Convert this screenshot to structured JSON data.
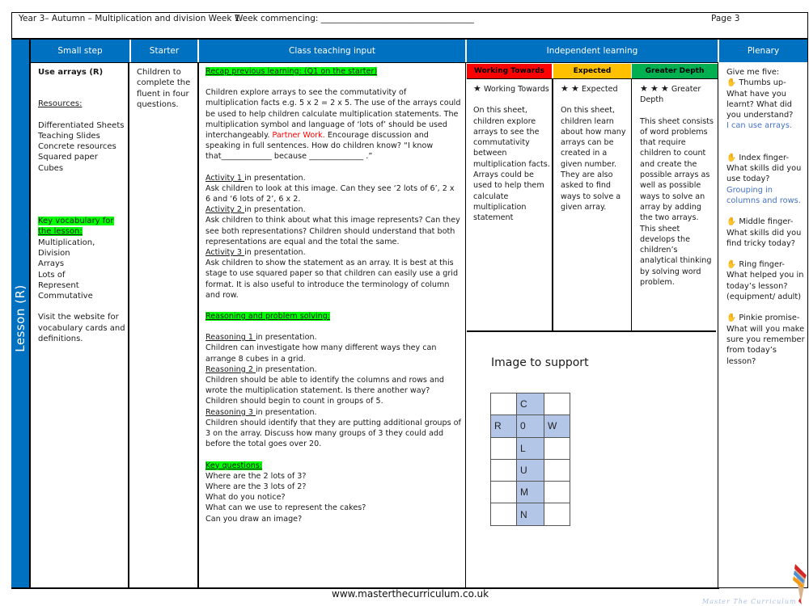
{
  "header": {
    "title": "Year 3– Autumn – Multiplication and division Week  1",
    "week_commencing": "Week commencing: ____________________________________",
    "page": "Page 3"
  },
  "side_label": "Lesson  (R)",
  "columns": {
    "small_step": "Small step",
    "starter": "Starter",
    "class_teaching": "Class teaching input",
    "independent": "Independent learning",
    "plenary": "Plenary"
  },
  "small_step": {
    "title": "Use arrays (R)",
    "resources_heading": "Resources:",
    "resources": [
      "Differentiated Sheets",
      "Teaching Slides",
      "Concrete resources",
      "Squared paper",
      "Cubes"
    ],
    "vocab_heading_1": "Key vocabulary for",
    "vocab_heading_2": "the lesson:",
    "vocabulary": [
      "Multiplication,",
      "Division",
      "Arrays",
      "Lots of",
      "Represent",
      "Commutative"
    ],
    "website_note": "Visit the website for vocabulary cards and definitions."
  },
  "starter": {
    "text": "Children to complete the fluent in four questions."
  },
  "teaching": {
    "recap_heading": "Recap previous learning: (Q1 on the starter)",
    "intro": "Children explore arrays to see the commutativity of multiplication facts e.g. 5 x 2 = 2 x 5. The use of the arrays could be used to help children calculate multiplication statements. The multiplication symbol and language of ‘lots of’ should be used interchangeably.",
    "partner_work": "Partner Work.",
    "partner_rest": " Encourage discussion and speaking in full sentences. How do children know?  “I know that_____________ because ______________ .”",
    "activities": [
      {
        "label": "Activity 1 ",
        "suffix": "in presentation.",
        "text": "Ask children to look at this image. Can they see ‘2 lots of 6’, 2 x 6 and  ‘6 lots of 2’, 6 x 2."
      },
      {
        "label": "Activity 2 ",
        "suffix": "in presentation.",
        "text": "Ask children to think about what this image represents? Can they see both representations? Children should understand that both representations are equal and the total the same."
      },
      {
        "label": "Activity 3 ",
        "suffix": "in presentation.",
        "text": "Ask children to show the statement as an array. It is best at this stage to use squared paper so that children can easily use a grid format. It is also useful to introduce the terminology of column and row."
      }
    ],
    "reasoning_heading": "Reasoning and problem solving:",
    "reasoning": [
      {
        "label": "Reasoning 1 ",
        "suffix": "in presentation.",
        "text": "Children can investigate how many different ways they can arrange 8 cubes in a grid."
      },
      {
        "label": "Reasoning 2 ",
        "suffix": "in presentation.",
        "text": "Children should be able to identify the columns and rows and wrote the multiplication statement.  Is there another way? Children should begin to count in groups of 5."
      },
      {
        "label": "Reasoning 3 ",
        "suffix": "in presentation.",
        "text": "Children should identify that they are putting additional groups of 3 on the array. Discuss how many groups of 3 they could add before the total goes over 20."
      }
    ],
    "key_questions_heading": "Key questions:",
    "key_questions": [
      "Where are the 2 lots of 3?",
      "Where are the 3 lots of 2?",
      "What do you notice?",
      "What can we use to represent the cakes?",
      "Can you draw an image?"
    ]
  },
  "independent": {
    "levels": [
      {
        "band": "Working Towards",
        "color": "#ff0000",
        "stars": 1,
        "title": "Working Towards",
        "text": "On this sheet, children explore arrays to see the commutativity between multiplication facts. Arrays could be used to help them calculate multiplication statement"
      },
      {
        "band": "Expected",
        "color": "#ffc000",
        "stars": 2,
        "title": "Expected",
        "text": "On this sheet, children learn about how many arrays can be created in a given number. They are also asked to find ways to solve a given array."
      },
      {
        "band": "Greater Depth",
        "color": "#00b050",
        "stars": 3,
        "title": "Greater Depth",
        "text": "This sheet consists of word problems that require children to count and create the possible arrays as well as possible ways to solve an array by adding the two arrays. This sheet develops the children’s analytical thinking by solving word problem."
      }
    ],
    "star_icon": "★",
    "image_heading": "Image to support",
    "grid": [
      [
        "",
        "C",
        ""
      ],
      [
        "R",
        "0",
        "W"
      ],
      [
        "",
        "L",
        ""
      ],
      [
        "",
        "U",
        ""
      ],
      [
        "",
        "M",
        ""
      ],
      [
        "",
        "N",
        ""
      ]
    ],
    "grid_highlight_color": "#b4c6e7"
  },
  "plenary": {
    "intro": "Give me five:",
    "hand_icon": "✋",
    "items": [
      {
        "prompt": "Thumbs up- What have you learnt? What did you understand?",
        "answer": "I can use arrays."
      },
      {
        "prompt": "Index finger- What skills did you use today?",
        "answer": "Grouping in columns and rows."
      },
      {
        "prompt": "Middle finger- What skills did you find tricky today?",
        "answer": ""
      },
      {
        "prompt": "Ring finger- What helped you in today’s lesson? (equipment/ adult)",
        "answer": ""
      },
      {
        "prompt": "Pinkie promise- What will you make sure you remember from today’s lesson?",
        "answer": ""
      }
    ]
  },
  "footer": {
    "url": "www.masterthecurriculum.co.uk",
    "logo_text": "Master The Curriculum"
  }
}
